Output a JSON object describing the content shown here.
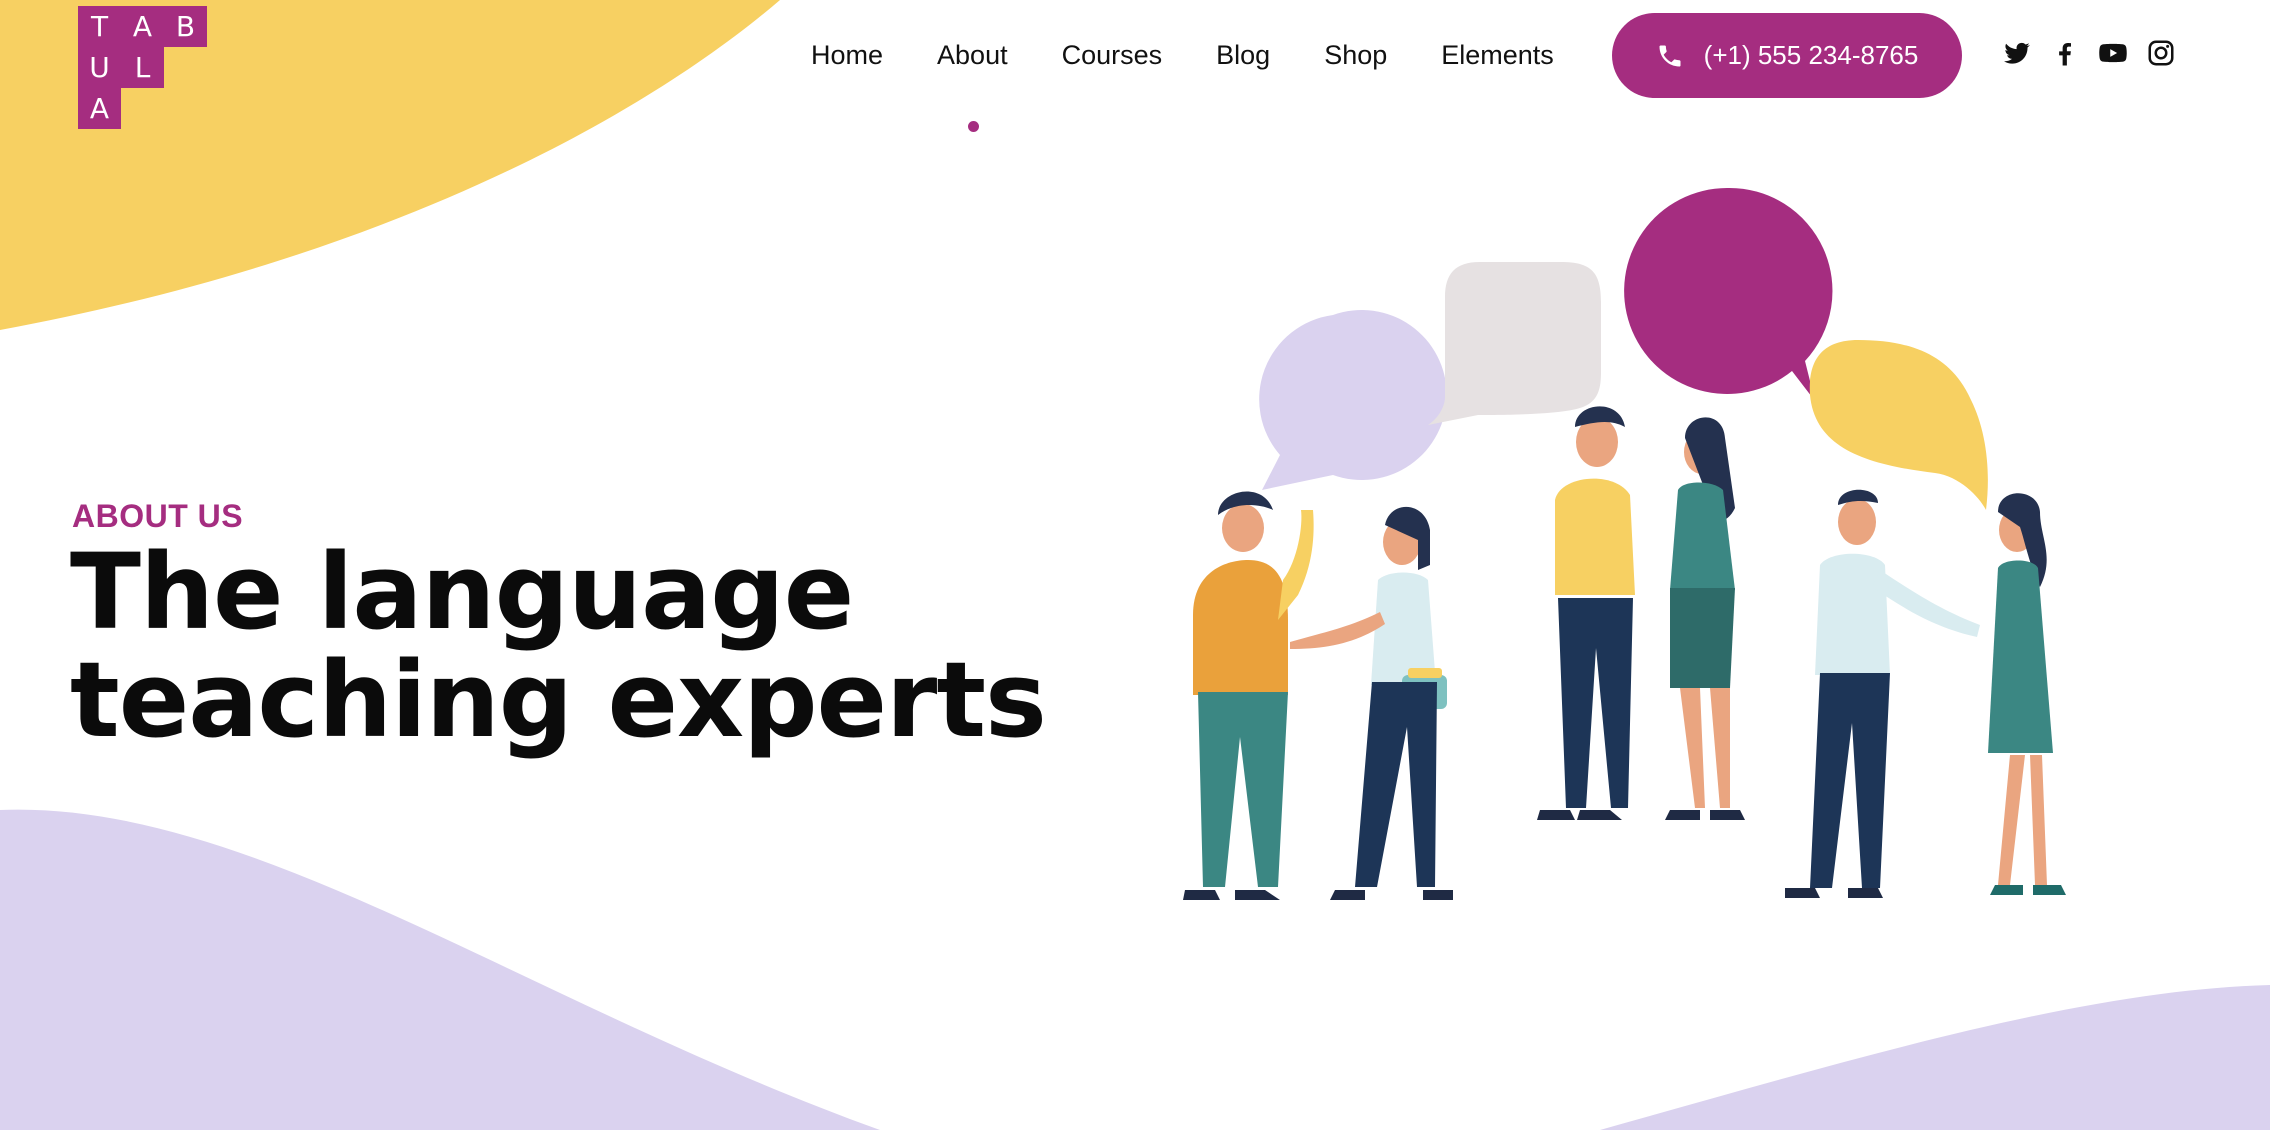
{
  "brand": {
    "logo_letters": [
      "T",
      "A",
      "B",
      "U",
      "L",
      "A"
    ],
    "colors": {
      "accent": "#a52d80",
      "yellow": "#f7d062",
      "lavender": "#dad2ef"
    }
  },
  "nav": {
    "items": [
      "Home",
      "About",
      "Courses",
      "Blog",
      "Shop",
      "Elements"
    ],
    "active": "About"
  },
  "contact": {
    "phone": "(+1) 555 234-8765",
    "icon": "phone-icon"
  },
  "social": [
    "twitter-icon",
    "facebook-icon",
    "youtube-icon",
    "instagram-icon"
  ],
  "hero": {
    "eyebrow": "ABOUT US",
    "title_line1": "The language",
    "title_line2": "teaching experts"
  }
}
